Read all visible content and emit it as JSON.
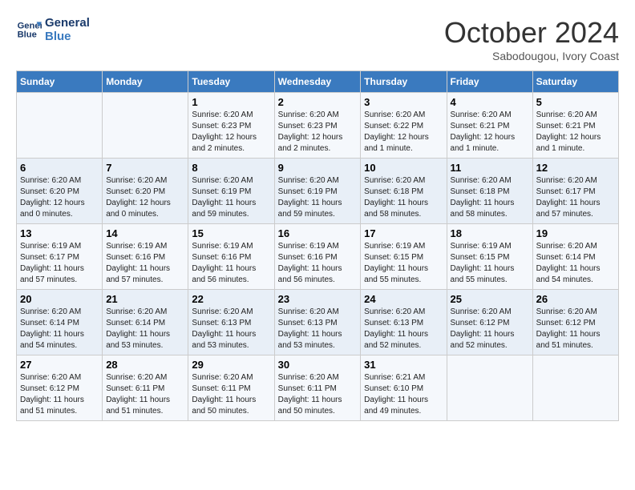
{
  "logo": {
    "line1": "General",
    "line2": "Blue"
  },
  "title": "October 2024",
  "subtitle": "Sabodougou, Ivory Coast",
  "days_header": [
    "Sunday",
    "Monday",
    "Tuesday",
    "Wednesday",
    "Thursday",
    "Friday",
    "Saturday"
  ],
  "weeks": [
    [
      {
        "num": "",
        "info": ""
      },
      {
        "num": "",
        "info": ""
      },
      {
        "num": "1",
        "info": "Sunrise: 6:20 AM\nSunset: 6:23 PM\nDaylight: 12 hours\nand 2 minutes."
      },
      {
        "num": "2",
        "info": "Sunrise: 6:20 AM\nSunset: 6:23 PM\nDaylight: 12 hours\nand 2 minutes."
      },
      {
        "num": "3",
        "info": "Sunrise: 6:20 AM\nSunset: 6:22 PM\nDaylight: 12 hours\nand 1 minute."
      },
      {
        "num": "4",
        "info": "Sunrise: 6:20 AM\nSunset: 6:21 PM\nDaylight: 12 hours\nand 1 minute."
      },
      {
        "num": "5",
        "info": "Sunrise: 6:20 AM\nSunset: 6:21 PM\nDaylight: 12 hours\nand 1 minute."
      }
    ],
    [
      {
        "num": "6",
        "info": "Sunrise: 6:20 AM\nSunset: 6:20 PM\nDaylight: 12 hours\nand 0 minutes."
      },
      {
        "num": "7",
        "info": "Sunrise: 6:20 AM\nSunset: 6:20 PM\nDaylight: 12 hours\nand 0 minutes."
      },
      {
        "num": "8",
        "info": "Sunrise: 6:20 AM\nSunset: 6:19 PM\nDaylight: 11 hours\nand 59 minutes."
      },
      {
        "num": "9",
        "info": "Sunrise: 6:20 AM\nSunset: 6:19 PM\nDaylight: 11 hours\nand 59 minutes."
      },
      {
        "num": "10",
        "info": "Sunrise: 6:20 AM\nSunset: 6:18 PM\nDaylight: 11 hours\nand 58 minutes."
      },
      {
        "num": "11",
        "info": "Sunrise: 6:20 AM\nSunset: 6:18 PM\nDaylight: 11 hours\nand 58 minutes."
      },
      {
        "num": "12",
        "info": "Sunrise: 6:20 AM\nSunset: 6:17 PM\nDaylight: 11 hours\nand 57 minutes."
      }
    ],
    [
      {
        "num": "13",
        "info": "Sunrise: 6:19 AM\nSunset: 6:17 PM\nDaylight: 11 hours\nand 57 minutes."
      },
      {
        "num": "14",
        "info": "Sunrise: 6:19 AM\nSunset: 6:16 PM\nDaylight: 11 hours\nand 57 minutes."
      },
      {
        "num": "15",
        "info": "Sunrise: 6:19 AM\nSunset: 6:16 PM\nDaylight: 11 hours\nand 56 minutes."
      },
      {
        "num": "16",
        "info": "Sunrise: 6:19 AM\nSunset: 6:16 PM\nDaylight: 11 hours\nand 56 minutes."
      },
      {
        "num": "17",
        "info": "Sunrise: 6:19 AM\nSunset: 6:15 PM\nDaylight: 11 hours\nand 55 minutes."
      },
      {
        "num": "18",
        "info": "Sunrise: 6:19 AM\nSunset: 6:15 PM\nDaylight: 11 hours\nand 55 minutes."
      },
      {
        "num": "19",
        "info": "Sunrise: 6:20 AM\nSunset: 6:14 PM\nDaylight: 11 hours\nand 54 minutes."
      }
    ],
    [
      {
        "num": "20",
        "info": "Sunrise: 6:20 AM\nSunset: 6:14 PM\nDaylight: 11 hours\nand 54 minutes."
      },
      {
        "num": "21",
        "info": "Sunrise: 6:20 AM\nSunset: 6:14 PM\nDaylight: 11 hours\nand 53 minutes."
      },
      {
        "num": "22",
        "info": "Sunrise: 6:20 AM\nSunset: 6:13 PM\nDaylight: 11 hours\nand 53 minutes."
      },
      {
        "num": "23",
        "info": "Sunrise: 6:20 AM\nSunset: 6:13 PM\nDaylight: 11 hours\nand 53 minutes."
      },
      {
        "num": "24",
        "info": "Sunrise: 6:20 AM\nSunset: 6:13 PM\nDaylight: 11 hours\nand 52 minutes."
      },
      {
        "num": "25",
        "info": "Sunrise: 6:20 AM\nSunset: 6:12 PM\nDaylight: 11 hours\nand 52 minutes."
      },
      {
        "num": "26",
        "info": "Sunrise: 6:20 AM\nSunset: 6:12 PM\nDaylight: 11 hours\nand 51 minutes."
      }
    ],
    [
      {
        "num": "27",
        "info": "Sunrise: 6:20 AM\nSunset: 6:12 PM\nDaylight: 11 hours\nand 51 minutes."
      },
      {
        "num": "28",
        "info": "Sunrise: 6:20 AM\nSunset: 6:11 PM\nDaylight: 11 hours\nand 51 minutes."
      },
      {
        "num": "29",
        "info": "Sunrise: 6:20 AM\nSunset: 6:11 PM\nDaylight: 11 hours\nand 50 minutes."
      },
      {
        "num": "30",
        "info": "Sunrise: 6:20 AM\nSunset: 6:11 PM\nDaylight: 11 hours\nand 50 minutes."
      },
      {
        "num": "31",
        "info": "Sunrise: 6:21 AM\nSunset: 6:10 PM\nDaylight: 11 hours\nand 49 minutes."
      },
      {
        "num": "",
        "info": ""
      },
      {
        "num": "",
        "info": ""
      }
    ]
  ]
}
